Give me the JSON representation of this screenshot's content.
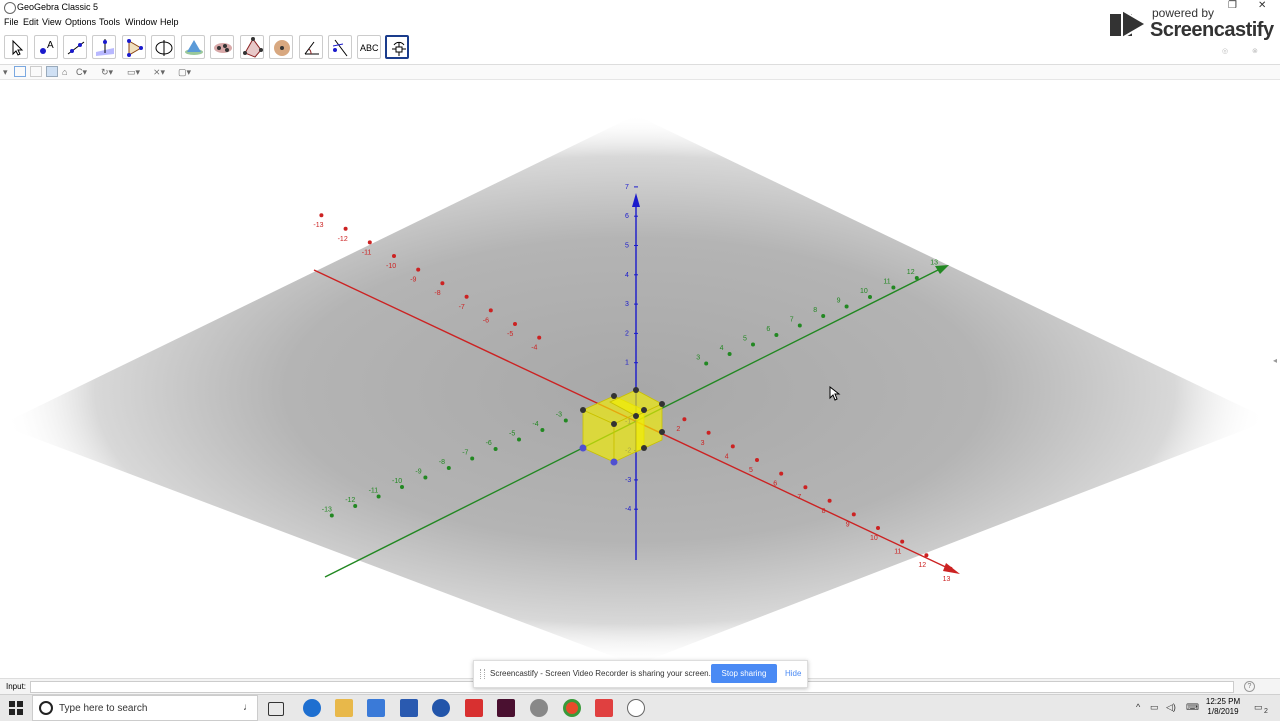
{
  "window": {
    "title": "GeoGebra Classic 5"
  },
  "menu": [
    "File",
    "Edit",
    "View",
    "Options",
    "Tools",
    "Window",
    "Help"
  ],
  "toolbar": {
    "tools": [
      "move-tool",
      "point-tool",
      "line-tool",
      "perpendicular-tool",
      "polygon-tool",
      "circle-tool",
      "intersect-surfaces-tool",
      "plane-tool",
      "pyramid-tool",
      "sphere-tool",
      "angle-tool",
      "reflect-tool",
      "text-tool",
      "rotate-view-tool"
    ],
    "text_tool_label": "ABC"
  },
  "graphics": {
    "x_axis_color": "#cc2222",
    "y_axis_color": "#228822",
    "z_axis_color": "#1a1acc",
    "object_color": "#f5f000",
    "x_ticks": [
      "-13",
      "-12",
      "-11",
      "-10",
      "-9",
      "-8",
      "-7",
      "-6",
      "-5",
      "-4",
      "2",
      "3",
      "4",
      "5",
      "6",
      "7",
      "8",
      "9",
      "10",
      "11",
      "12",
      "13"
    ],
    "y_ticks": [
      "-13",
      "-12",
      "-11",
      "-10",
      "-9",
      "-8",
      "-7",
      "-6",
      "-5",
      "-4",
      "-3",
      "3",
      "4",
      "5",
      "6",
      "7",
      "8",
      "9",
      "10",
      "11",
      "12",
      "13"
    ],
    "z_ticks": [
      "7",
      "6",
      "5",
      "4",
      "3",
      "2",
      "1",
      "-1",
      "-2",
      "-3",
      "-4"
    ]
  },
  "input_bar": {
    "label": "Input:",
    "value": ""
  },
  "screencastify": {
    "watermark_top": "powered by",
    "watermark_brand": "Screencastify",
    "share_message": "Screencastify - Screen Video Recorder is sharing your screen.",
    "stop_label": "Stop sharing",
    "hide_label": "Hide"
  },
  "taskbar": {
    "search_placeholder": "Type here to search",
    "time": "12:25 PM",
    "date": "1/8/2019",
    "notification_count": "2"
  }
}
